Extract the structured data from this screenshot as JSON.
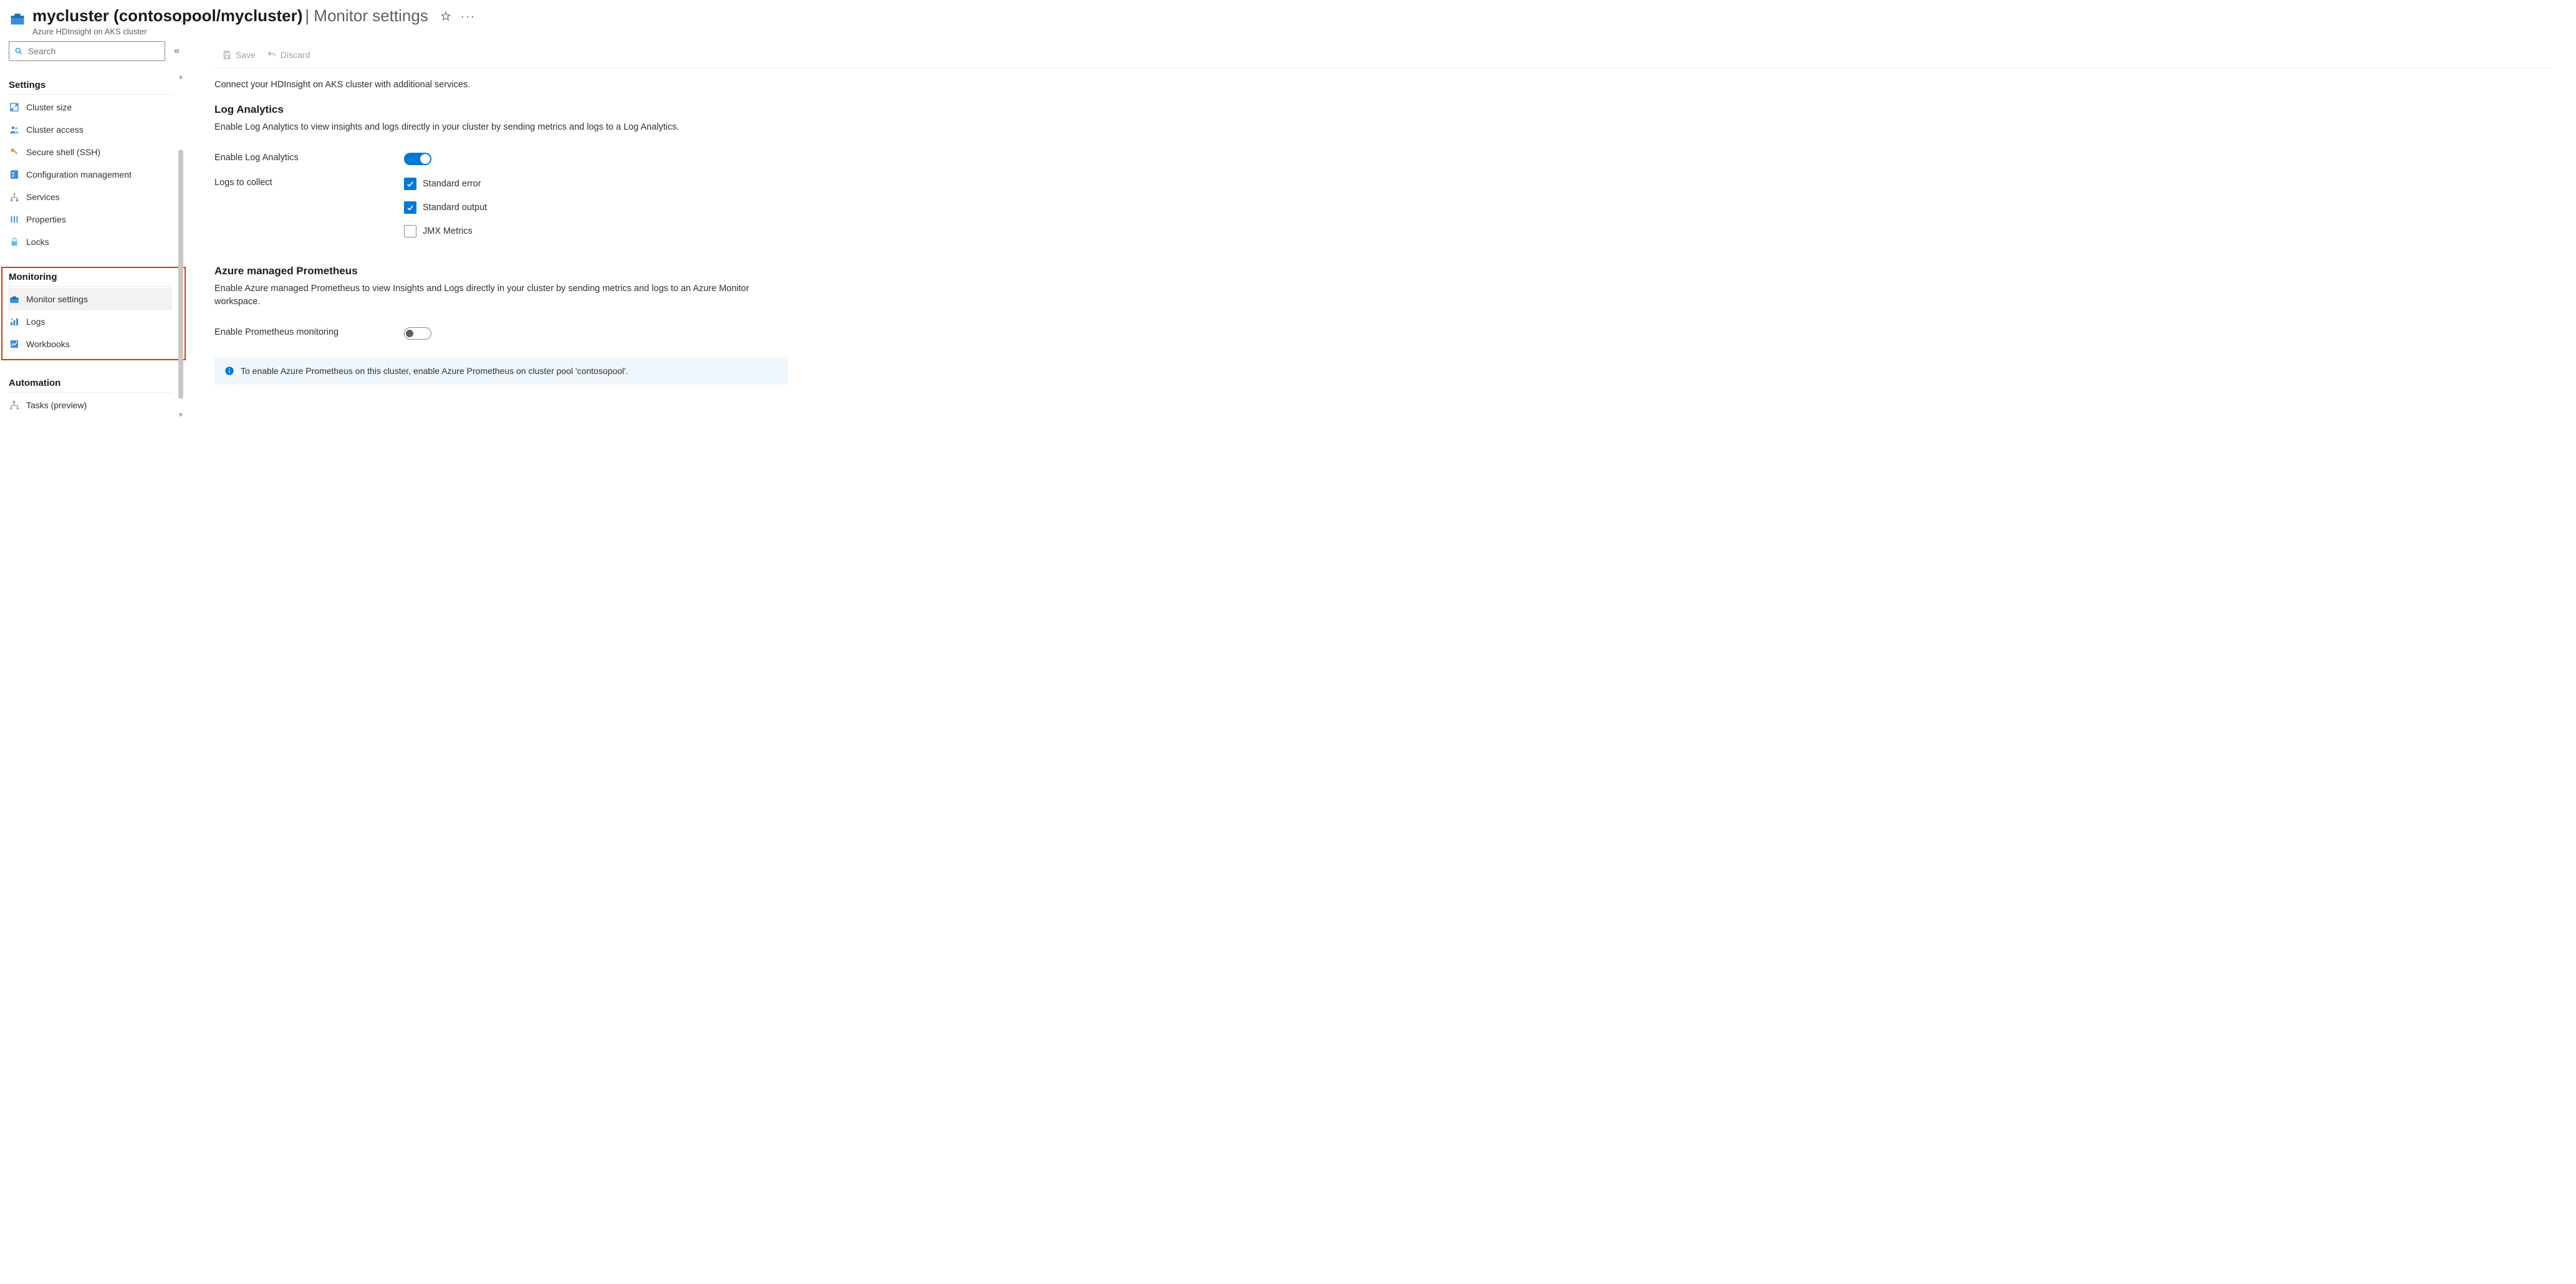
{
  "header": {
    "title_main": "mycluster (contosopool/mycluster)",
    "title_suffix": "Monitor settings",
    "subtitle": "Azure HDInsight on AKS cluster"
  },
  "search": {
    "placeholder": "Search"
  },
  "sidebar": {
    "groups": [
      {
        "title": "Settings",
        "items": [
          {
            "label": "Cluster size",
            "icon": "resize"
          },
          {
            "label": "Cluster access",
            "icon": "people"
          },
          {
            "label": "Secure shell (SSH)",
            "icon": "key"
          },
          {
            "label": "Configuration management",
            "icon": "checklist"
          },
          {
            "label": "Services",
            "icon": "hierarchy"
          },
          {
            "label": "Properties",
            "icon": "bars"
          },
          {
            "label": "Locks",
            "icon": "lock"
          }
        ]
      },
      {
        "title": "Monitoring",
        "highlight": true,
        "items": [
          {
            "label": "Monitor settings",
            "icon": "toolbox",
            "active": true
          },
          {
            "label": "Logs",
            "icon": "logs"
          },
          {
            "label": "Workbooks",
            "icon": "workbook"
          }
        ]
      },
      {
        "title": "Automation",
        "items": [
          {
            "label": "Tasks (preview)",
            "icon": "tasks"
          }
        ]
      }
    ]
  },
  "commands": {
    "save": "Save",
    "discard": "Discard"
  },
  "main": {
    "intro": "Connect your HDInsight on AKS cluster with additional services.",
    "log_analytics": {
      "title": "Log Analytics",
      "desc": "Enable Log Analytics to view insights and logs directly in your cluster by sending metrics and logs to a Log Analytics.",
      "enable_label": "Enable Log Analytics",
      "enable_on": true,
      "logs_label": "Logs to collect",
      "checks": [
        {
          "label": "Standard error",
          "checked": true
        },
        {
          "label": "Standard output",
          "checked": true
        },
        {
          "label": "JMX Metrics",
          "checked": false
        }
      ]
    },
    "prometheus": {
      "title": "Azure managed Prometheus",
      "desc": "Enable Azure managed Prometheus to view Insights and Logs directly in your cluster by sending metrics and logs to an Azure Monitor workspace.",
      "enable_label": "Enable Prometheus monitoring",
      "enable_on": false,
      "info": "To enable Azure Prometheus on this cluster, enable Azure Prometheus on cluster pool 'contosopool'."
    }
  }
}
